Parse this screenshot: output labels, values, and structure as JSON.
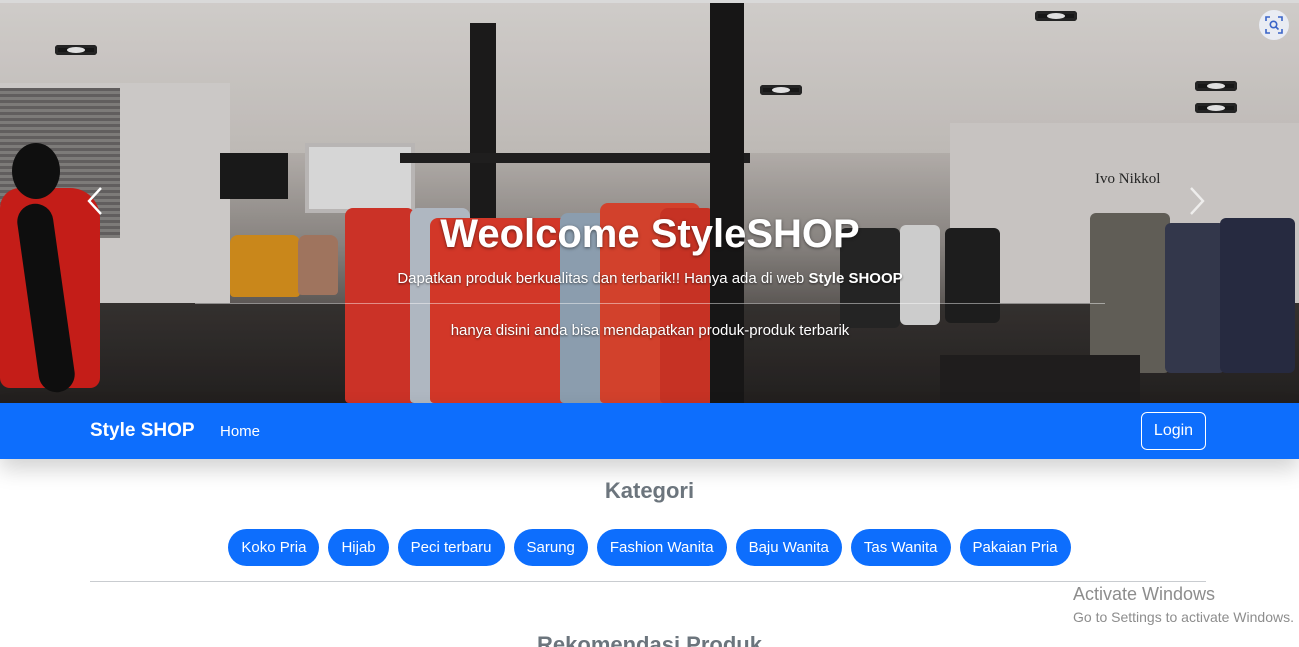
{
  "hero": {
    "title": "Weolcome StyleSHOP",
    "subtitle_text": "Dapatkan produk berkualitas dan terbarik!! Hanya ada di web ",
    "subtitle_bold": "Style SHOOP",
    "tagline": "hanya disini anda bisa mendapatkan produk-produk terbarik",
    "prev_icon": "chevron-left-icon",
    "next_icon": "chevron-right-icon",
    "sign_text": "Ivo Nikkol"
  },
  "navbar": {
    "brand": "Style SHOP",
    "links": [
      "Home"
    ],
    "login_label": "Login",
    "color": "#0d6efd"
  },
  "kategori": {
    "title": "Kategori",
    "items": [
      "Koko Pria",
      "Hijab",
      "Peci terbaru",
      "Sarung",
      "Fashion Wanita",
      "Baju Wanita",
      "Tas Wanita",
      "Pakaian Pria"
    ]
  },
  "rekomendasi": {
    "title": "Rekomendasi Produk"
  },
  "watermark": {
    "line1": "Activate Windows",
    "line2": "Go to Settings to activate Windows."
  },
  "overlay_icon": "visual-search-icon"
}
